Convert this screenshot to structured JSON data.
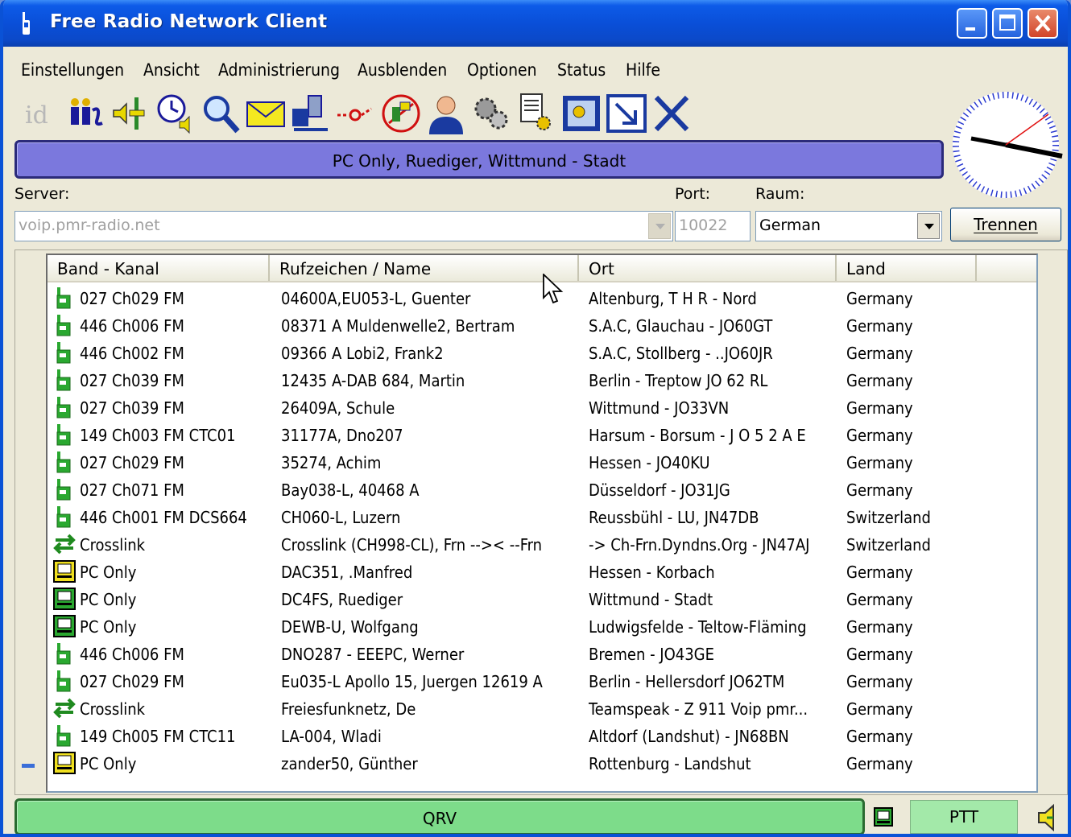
{
  "window": {
    "title": "Free Radio Network Client"
  },
  "menu": [
    "Einstellungen",
    "Ansicht",
    "Administrierung",
    "Ausblenden",
    "Optionen",
    "Status",
    "Hilfe"
  ],
  "toolbar_icons": [
    "id-icon",
    "people-icon",
    "volume-slider-icon",
    "clock-sound-icon",
    "magnifier-icon",
    "envelope-icon",
    "network-icon",
    "red-dot-icon",
    "microphone-phone-icon",
    "user-icon",
    "gears-icon",
    "document-gear-icon",
    "image-icon",
    "resize-arrow-icon",
    "close-x-icon"
  ],
  "status": {
    "text": "PC Only, Ruediger, Wittmund - Stadt"
  },
  "connection": {
    "server_label": "Server:",
    "server_value": "voip.pmr-radio.net",
    "port_label": "Port:",
    "port_value": "10022",
    "room_label": "Raum:",
    "room_value": "German",
    "disconnect_label": "Trennen"
  },
  "columns": [
    "Band - Kanal",
    "Rufzeichen / Name",
    "Ort",
    "Land"
  ],
  "rows": [
    {
      "icon": "radio",
      "band": "027 Ch029 FM",
      "name": "04600A,EU053-L, Guenter",
      "ort": "Altenburg, T H R - Nord",
      "land": "Germany"
    },
    {
      "icon": "radio",
      "band": "446 Ch006 FM",
      "name": "08371 A Muldenwelle2, Bertram",
      "ort": "S.A.C, Glauchau - JO60GT",
      "land": "Germany"
    },
    {
      "icon": "radio",
      "band": "446 Ch002 FM",
      "name": "09366 A Lobi2, Frank2",
      "ort": "S.A.C, Stollberg - ..JO60JR",
      "land": "Germany"
    },
    {
      "icon": "radio",
      "band": "027 Ch039 FM",
      "name": "12435 A-DAB 684, Martin",
      "ort": "Berlin - Treptow JO 62 RL",
      "land": "Germany"
    },
    {
      "icon": "radio",
      "band": "027 Ch039 FM",
      "name": "26409A, Schule",
      "ort": "Wittmund - JO33VN",
      "land": "Germany"
    },
    {
      "icon": "radio",
      "band": "149 Ch003 FM CTC01",
      "name": "31177A, Dno207",
      "ort": "Harsum - Borsum - J O 5 2 A E",
      "land": "Germany"
    },
    {
      "icon": "radio",
      "band": "027 Ch029 FM",
      "name": "35274, Achim",
      "ort": "Hessen - JO40KU",
      "land": "Germany"
    },
    {
      "icon": "radio",
      "band": "027 Ch071 FM",
      "name": "Bay038-L, 40468 A",
      "ort": "Düsseldorf - JO31JG",
      "land": "Germany"
    },
    {
      "icon": "radio",
      "band": "446 Ch001 FM DCS664",
      "name": "CH060-L, Luzern",
      "ort": "Reussbühl - LU, JN47DB",
      "land": "Switzerland"
    },
    {
      "icon": "crosslink",
      "band": "Crosslink",
      "name": "Crosslink (CH998-CL), Frn -->< --Frn",
      "ort": "-> Ch-Frn.Dyndns.Org - JN47AJ",
      "land": "Switzerland"
    },
    {
      "icon": "pc-yellow",
      "band": "PC Only",
      "name": "DAC351, .Manfred",
      "ort": "Hessen -  Korbach",
      "land": "Germany"
    },
    {
      "icon": "pc-green",
      "band": "PC Only",
      "name": "DC4FS, Ruediger",
      "ort": "Wittmund - Stadt",
      "land": "Germany"
    },
    {
      "icon": "pc-green",
      "band": "PC Only",
      "name": "DEWB-U, Wolfgang",
      "ort": "Ludwigsfelde - Teltow-Fläming",
      "land": "Germany"
    },
    {
      "icon": "radio",
      "band": "446 Ch006 FM",
      "name": "DNO287 - EEEPC, Werner",
      "ort": "Bremen - JO43GE",
      "land": "Germany"
    },
    {
      "icon": "radio",
      "band": "027 Ch029 FM",
      "name": "Eu035-L Apollo 15, Juergen 12619 A",
      "ort": "Berlin - Hellersdorf JO62TM",
      "land": "Germany"
    },
    {
      "icon": "crosslink",
      "band": "Crosslink",
      "name": "Freiesfunknetz, De",
      "ort": "Teamspeak - Z 911 Voip pmr...",
      "land": "Germany"
    },
    {
      "icon": "radio",
      "band": "149 Ch005 FM CTC11",
      "name": "LA-004, Wladi",
      "ort": "Altdorf (Landshut) - JN68BN",
      "land": "Germany"
    },
    {
      "icon": "pc-yellow",
      "band": "PC Only",
      "name": "zander50, Günther",
      "ort": "Rottenburg - Landshut",
      "land": "Germany"
    }
  ],
  "footer": {
    "state": "QRV",
    "ptt_label": "PTT"
  },
  "colors": {
    "status_bar": "#7b78dd",
    "qrv_bar": "#7ddc8a",
    "ptt": "#a3e9a9",
    "titlebar": "#0a4fd8"
  }
}
